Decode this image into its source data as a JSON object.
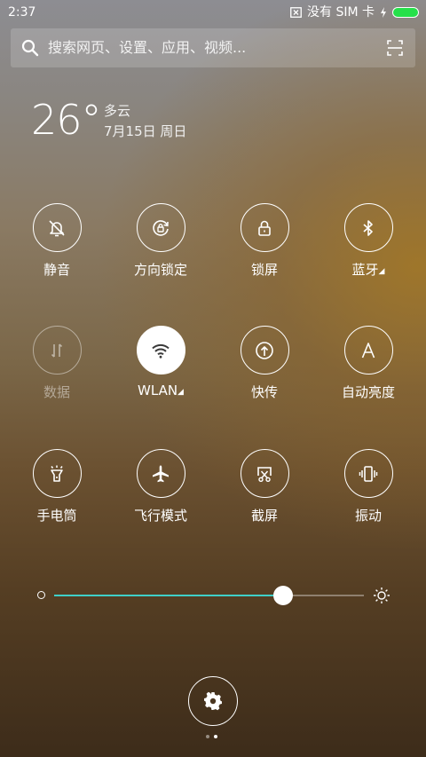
{
  "status_bar": {
    "time": "2:37",
    "sim_text": "没有 SIM 卡",
    "battery_color": "#26e04a"
  },
  "search": {
    "placeholder": "搜索网页、设置、应用、视频..."
  },
  "weather": {
    "temperature": "26°",
    "condition": "多云",
    "date": "7月15日 周日"
  },
  "toggles": [
    {
      "label": "静音",
      "icon": "bell-off-icon",
      "state": "off"
    },
    {
      "label": "方向锁定",
      "icon": "rotation-lock-icon",
      "state": "off"
    },
    {
      "label": "锁屏",
      "icon": "lock-icon",
      "state": "off"
    },
    {
      "label": "蓝牙",
      "icon": "bluetooth-icon",
      "state": "off",
      "has_more": true
    },
    {
      "label": "数据",
      "icon": "mobile-data-icon",
      "state": "disabled"
    },
    {
      "label": "WLAN",
      "icon": "wifi-icon",
      "state": "on",
      "has_more": true
    },
    {
      "label": "快传",
      "icon": "quick-transfer-icon",
      "state": "off"
    },
    {
      "label": "自动亮度",
      "icon": "auto-brightness-icon",
      "state": "off"
    },
    {
      "label": "手电筒",
      "icon": "flashlight-icon",
      "state": "off"
    },
    {
      "label": "飞行模式",
      "icon": "airplane-icon",
      "state": "off"
    },
    {
      "label": "截屏",
      "icon": "screenshot-icon",
      "state": "off"
    },
    {
      "label": "振动",
      "icon": "vibrate-icon",
      "state": "off"
    }
  ],
  "brightness": {
    "level": 0.74,
    "track_color": "#3fd0c8"
  },
  "pager": {
    "pages": 2,
    "current": 2
  }
}
